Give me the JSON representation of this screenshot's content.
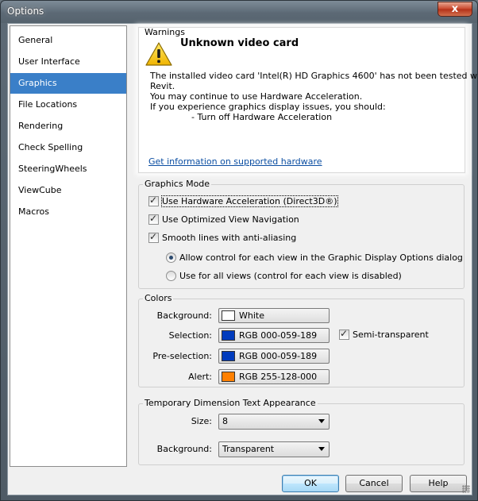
{
  "window": {
    "title": "Options",
    "close_glyph": "x"
  },
  "sidebar": {
    "items": [
      {
        "label": "General"
      },
      {
        "label": "User Interface"
      },
      {
        "label": "Graphics"
      },
      {
        "label": "File Locations"
      },
      {
        "label": "Rendering"
      },
      {
        "label": "Check Spelling"
      },
      {
        "label": "SteeringWheels"
      },
      {
        "label": "ViewCube"
      },
      {
        "label": "Macros"
      }
    ],
    "selected": "Graphics"
  },
  "warnings": {
    "group_label": "Warnings",
    "icon": "warning-triangle-icon",
    "title": "Unknown video card",
    "lines": [
      "The installed video card 'Intel(R) HD Graphics 4600' has not been tested with",
      "Revit.",
      "You may continue to use Hardware Acceleration.",
      "If you experience graphics display issues, you should:",
      "- Turn off Hardware Acceleration"
    ],
    "link": "Get information on supported hardware"
  },
  "graphics_mode": {
    "group_label": "Graphics Mode",
    "hardware_accel": {
      "label": "Use Hardware Acceleration (Direct3D®)",
      "checked": true
    },
    "optimized_nav": {
      "label": "Use Optimized View Navigation",
      "checked": true
    },
    "smooth_lines": {
      "label": "Smooth lines with anti-aliasing",
      "checked": true
    },
    "radio_allow": {
      "label": "Allow control for each view in the Graphic Display Options dialog",
      "checked": true
    },
    "radio_all": {
      "label": "Use for all views (control for each view is disabled)",
      "checked": false
    }
  },
  "colors": {
    "group_label": "Colors",
    "background": {
      "label": "Background:",
      "value": "White",
      "swatch": "#ffffff"
    },
    "selection": {
      "label": "Selection:",
      "value": "RGB 000-059-189",
      "swatch": "#003bbd"
    },
    "preselection": {
      "label": "Pre-selection:",
      "value": "RGB 000-059-189",
      "swatch": "#003bbd"
    },
    "alert": {
      "label": "Alert:",
      "value": "RGB 255-128-000",
      "swatch": "#ff8000"
    },
    "semi_transparent": {
      "label": "Semi-transparent",
      "checked": true
    }
  },
  "temp_dim": {
    "group_label": "Temporary Dimension Text Appearance",
    "size": {
      "label": "Size:",
      "value": "8"
    },
    "background": {
      "label": "Background:",
      "value": "Transparent"
    }
  },
  "footer": {
    "ok": "OK",
    "cancel": "Cancel",
    "help": "Help"
  }
}
